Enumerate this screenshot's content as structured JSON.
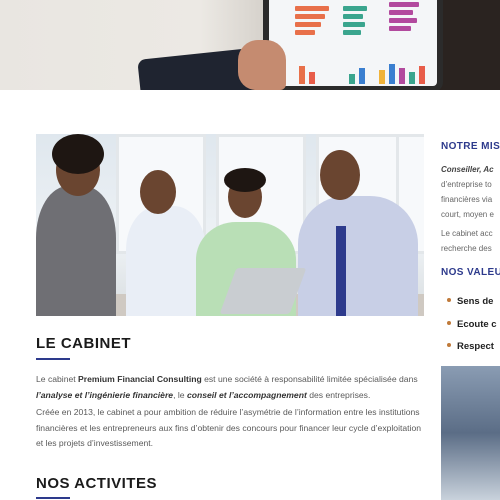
{
  "hero": {
    "image_alt": "Tablet showing financial charts held by a businessman"
  },
  "main_photo": {
    "image_alt": "Team of professionals in a meeting"
  },
  "cabinet": {
    "title": "LE CABINET",
    "p1_prefix": "Le cabinet ",
    "p1_company": "Premium Financial Consulting",
    "p1_mid": " est une société à responsabilité limitée spécialisée dans ",
    "p1_analysis": "l’analyse et l’ingénierie financière",
    "p1_comma": ", le ",
    "p1_advice": "conseil et l’accompagnement",
    "p1_suffix": " des entreprises.",
    "p2": "Créée en 2013, le cabinet a pour ambition de réduire l’asymétrie de l’information entre les institutions financières et les entrepreneurs aux fins d’obtenir des concours pour financer leur cycle d’exploitation et les projets d’investissement."
  },
  "activities": {
    "title": "NOS ACTIVITES"
  },
  "mission": {
    "title": "NOTRE MIS",
    "line1": "Conseiller, Ac",
    "line2": "d’entreprise to",
    "line3": "financières via",
    "line4": "court, moyen e",
    "line5": "Le cabinet acc",
    "line6": "recherche des"
  },
  "values": {
    "title": "NOS VALEU",
    "items": [
      "Sens de",
      "Ecoute c",
      "Respect"
    ]
  },
  "colors": {
    "accent": "#2d3a8c",
    "bullet": "#c07a3a"
  }
}
